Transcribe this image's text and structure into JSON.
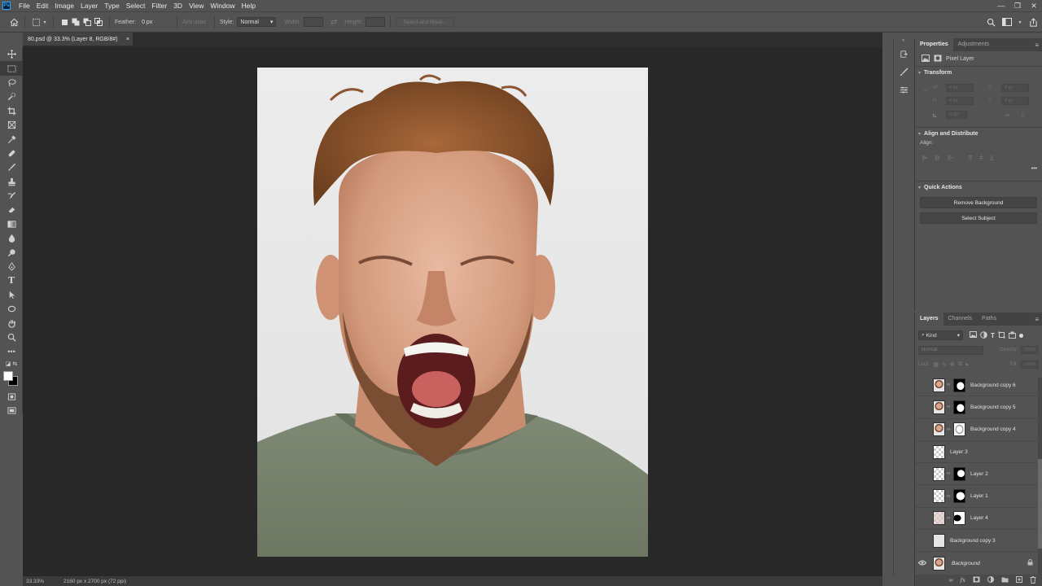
{
  "menu": [
    "File",
    "Edit",
    "Image",
    "Layer",
    "Type",
    "Select",
    "Filter",
    "3D",
    "View",
    "Window",
    "Help"
  ],
  "app_logo": "Ps",
  "window_controls": [
    "—",
    "❐",
    "✕"
  ],
  "options": {
    "feather_label": "Feather:",
    "feather_value": "0 px",
    "anti_alias_label": "Anti-alias",
    "style_label": "Style:",
    "style_value": "Normal",
    "width_label": "Width:",
    "height_label": "Height:",
    "mask_button": "Select and Mask..."
  },
  "document": {
    "tab_title": "80.psd @ 33.3% (Layer 8, RGB/8#)",
    "tab_close": "×"
  },
  "status": {
    "zoom": "33.33%",
    "doc_size": "2160 px x 2700 px (72 ppi)"
  },
  "properties": {
    "tabs": [
      "Properties",
      "Adjustments"
    ],
    "layer_type": "Pixel Layer",
    "transform_title": "Transform",
    "w_label": "W",
    "w_value": "4 px",
    "h_label": "H",
    "h_value": "4 px",
    "x_label": "X",
    "x_value": "0 px",
    "y_label": "Y",
    "y_value": "0 px",
    "angle_value": "0.00°",
    "align_title": "Align and Distribute",
    "align_label": "Align:",
    "more": "•••",
    "quick_actions_title": "Quick Actions",
    "remove_bg": "Remove Background",
    "select_subject": "Select Subject"
  },
  "layers_panel": {
    "tabs": [
      "Layers",
      "Channels",
      "Paths"
    ],
    "kind_label": "Kind",
    "blend_mode": "Normal",
    "opacity_label": "Opacity:",
    "opacity_value": "100%",
    "lock_label": "Lock:",
    "fill_label": "Fill:",
    "fill_value": "100%",
    "layers": [
      {
        "name": "Background copy 6",
        "thumb": "face",
        "mask": true,
        "visible": false
      },
      {
        "name": "Background copy 5",
        "thumb": "face",
        "mask": true,
        "visible": false
      },
      {
        "name": "Background copy 4",
        "thumb": "face",
        "mask": true,
        "visible": false
      },
      {
        "name": "Layer 3",
        "thumb": "checker",
        "mask": false,
        "visible": false
      },
      {
        "name": "Layer 2",
        "thumb": "checker",
        "mask": true,
        "visible": false
      },
      {
        "name": "Layer 1",
        "thumb": "checker",
        "mask": true,
        "visible": false
      },
      {
        "name": "Layer 4",
        "thumb": "checker",
        "mask": true,
        "visible": false
      },
      {
        "name": "Background copy 3",
        "thumb": "plain",
        "mask": false,
        "visible": false
      },
      {
        "name": "Background",
        "thumb": "face",
        "mask": false,
        "visible": true,
        "locked": true
      }
    ],
    "bottom_icons": [
      "link-icon",
      "fx-icon",
      "mask-icon",
      "adjustment-icon",
      "folder-icon",
      "new-layer-icon",
      "trash-icon"
    ]
  }
}
